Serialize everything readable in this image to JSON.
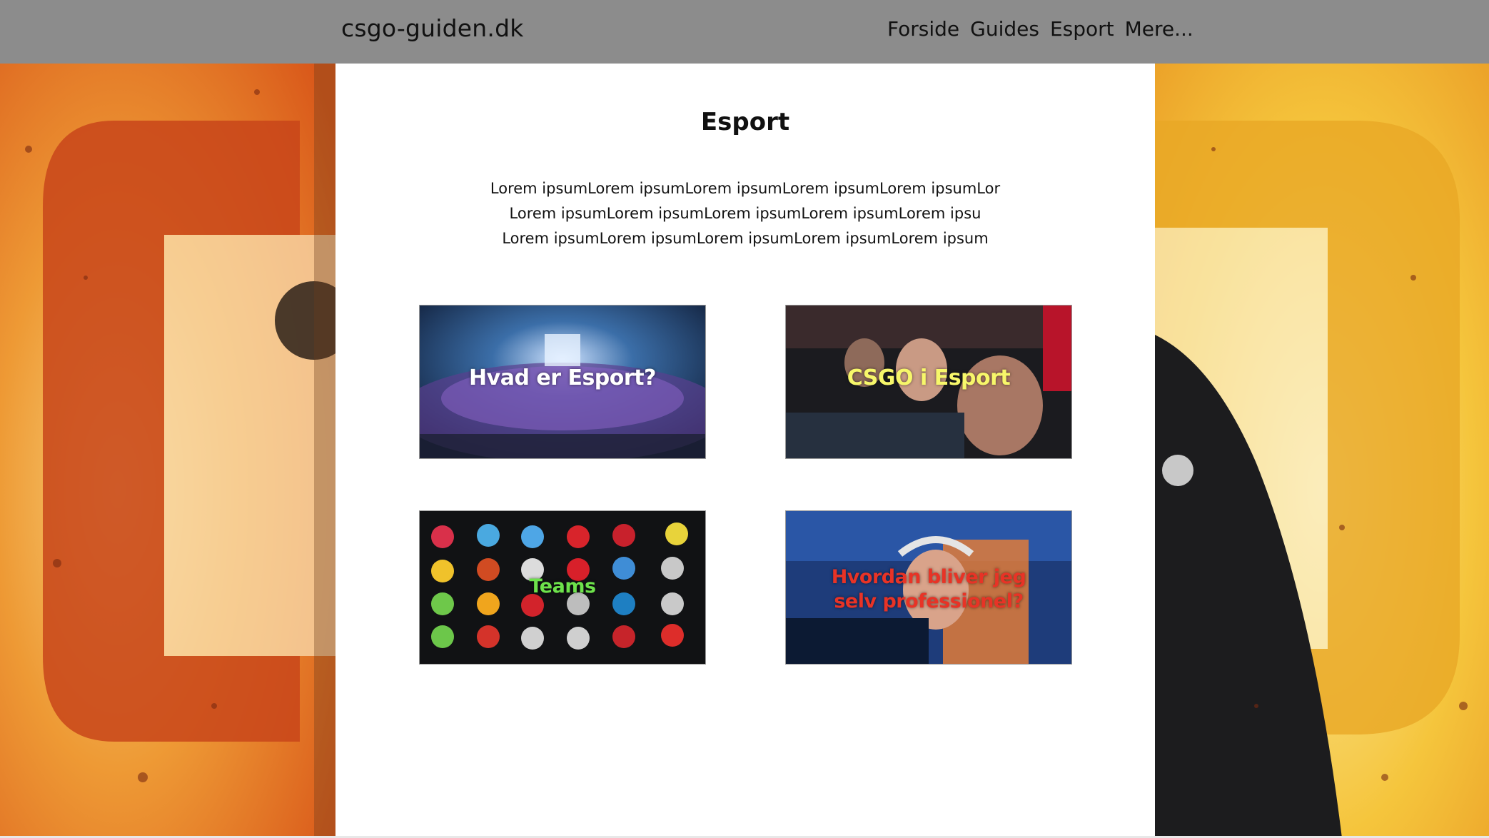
{
  "header": {
    "brand": "csgo-guiden.dk",
    "nav": [
      "Forside",
      "Guides",
      "Esport",
      "Mere..."
    ]
  },
  "main": {
    "title": "Esport",
    "intro_lines": [
      "Lorem ipsumLorem ipsumLorem ipsumLorem ipsumLorem ipsumLor",
      "Lorem ipsumLorem ipsumLorem ipsumLorem ipsumLorem ipsu",
      "Lorem ipsumLorem ipsumLorem ipsumLorem ipsumLorem ipsum"
    ],
    "cards": [
      {
        "title": "Hvad er Esport?",
        "color": "#ffffff"
      },
      {
        "title": "CSGO i Esport",
        "color": "#f7f76a"
      },
      {
        "title": "Teams",
        "color": "#6de24b"
      },
      {
        "title_line1": "Hvordan bliver jeg",
        "title_line2": "selv professionel?",
        "color": "#e83326"
      }
    ]
  },
  "colors": {
    "header_bg": "#8c8c8c",
    "panel_bg": "#ffffff",
    "background_orange": "#e8741c",
    "background_yellow": "#f3b62a"
  },
  "icons": {
    "logo_marks": [
      "team-logo-icon"
    ]
  }
}
